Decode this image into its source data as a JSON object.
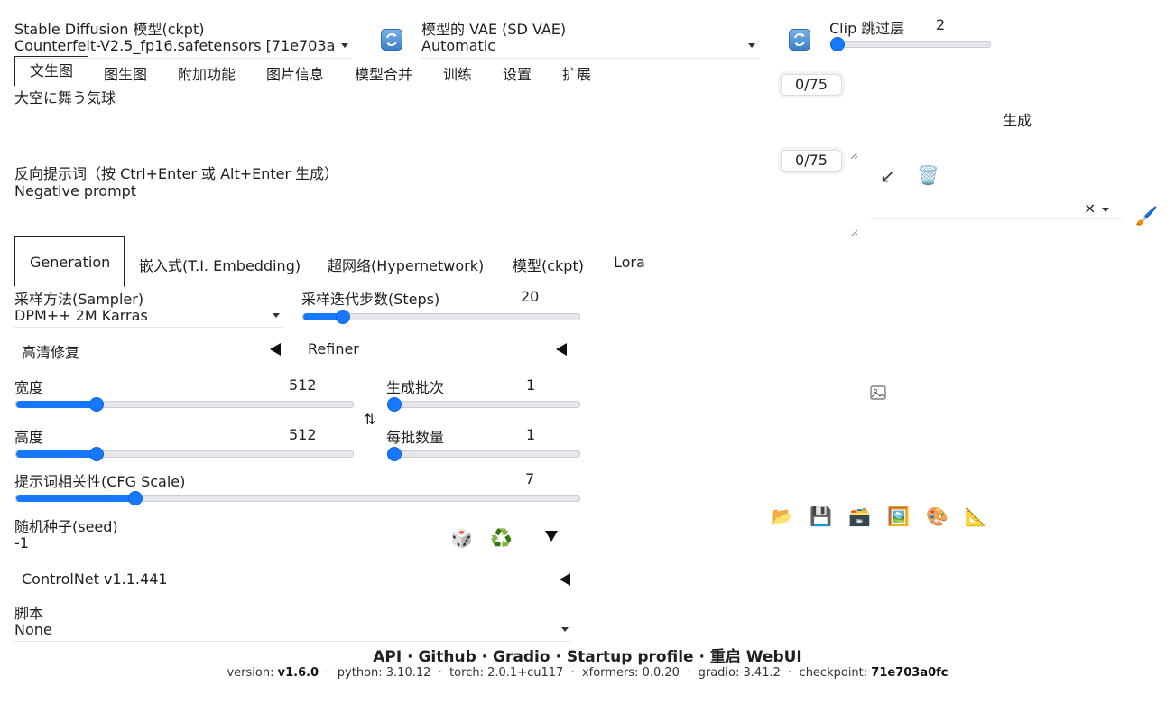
{
  "model": {
    "label": "Stable Diffusion 模型(ckpt)",
    "value": "Counterfeit-V2.5_fp16.safetensors [71e703a"
  },
  "vae": {
    "label": "模型的 VAE (SD VAE)",
    "value": "Automatic"
  },
  "clip": {
    "label": "Clip 跳过层",
    "value": "2",
    "fraction": 0.0
  },
  "tabs": [
    "文生图",
    "图生图",
    "附加功能",
    "图片信息",
    "模型合并",
    "训练",
    "设置",
    "扩展"
  ],
  "prompt": {
    "value": "大空に舞う気球",
    "counter": "0/75"
  },
  "negative": {
    "label": "反向提示词（按 Ctrl+Enter 或 Alt+Enter 生成）",
    "placeholder": "Negative prompt",
    "counter": "0/75"
  },
  "generate_label": "生成",
  "style_select": {
    "clear": "×"
  },
  "subtabs": [
    "Generation",
    "嵌入式(T.I. Embedding)",
    "超网络(Hypernetwork)",
    "模型(ckpt)",
    "Lora"
  ],
  "sampler": {
    "label": "采样方法(Sampler)",
    "value": "DPM++ 2M Karras"
  },
  "steps": {
    "label": "采样迭代步数(Steps)",
    "value": "20",
    "fraction": 0.14
  },
  "hires": {
    "label": "高清修复"
  },
  "refiner": {
    "label": "Refiner"
  },
  "width": {
    "label": "宽度",
    "value": "512",
    "fraction": 0.235
  },
  "height": {
    "label": "高度",
    "value": "512",
    "fraction": 0.235
  },
  "batch_count": {
    "label": "生成批次",
    "value": "1",
    "fraction": 0.0
  },
  "batch_size": {
    "label": "每批数量",
    "value": "1",
    "fraction": 0.0
  },
  "swap_icon": "⇅",
  "cfg": {
    "label": "提示词相关性(CFG Scale)",
    "value": "7",
    "fraction": 0.21
  },
  "seed": {
    "label": "随机种子(seed)",
    "value": "-1"
  },
  "controlnet": {
    "label": "ControlNet v1.1.441"
  },
  "script": {
    "label": "脚本",
    "value": "None"
  },
  "icons": {
    "dice": "🎲",
    "recycle": "♻️",
    "folder": "📂",
    "save": "💾",
    "zip": "🗃️",
    "image": "🖼️",
    "palette": "🎨",
    "ruler": "📐",
    "arrow": "↙",
    "trash": "🗑️",
    "brush": "🖌️"
  },
  "footer": {
    "links": [
      "API",
      "Github",
      "Gradio",
      "Startup profile",
      "重启 WebUI"
    ],
    "sep": " · ",
    "info": [
      {
        "k": "version: ",
        "v": "v1.6.0"
      },
      {
        "k": "python: ",
        "v": "3.10.12",
        "plain": true
      },
      {
        "k": "torch: ",
        "v": "2.0.1+cu117",
        "plain": true
      },
      {
        "k": "xformers: ",
        "v": "0.0.20",
        "plain": true
      },
      {
        "k": "gradio: ",
        "v": "3.41.2",
        "plain": true
      },
      {
        "k": "checkpoint: ",
        "v": "71e703a0fc"
      }
    ]
  },
  "colors": {
    "accent": "#1677ff",
    "refresh": "#3b7fc8"
  }
}
